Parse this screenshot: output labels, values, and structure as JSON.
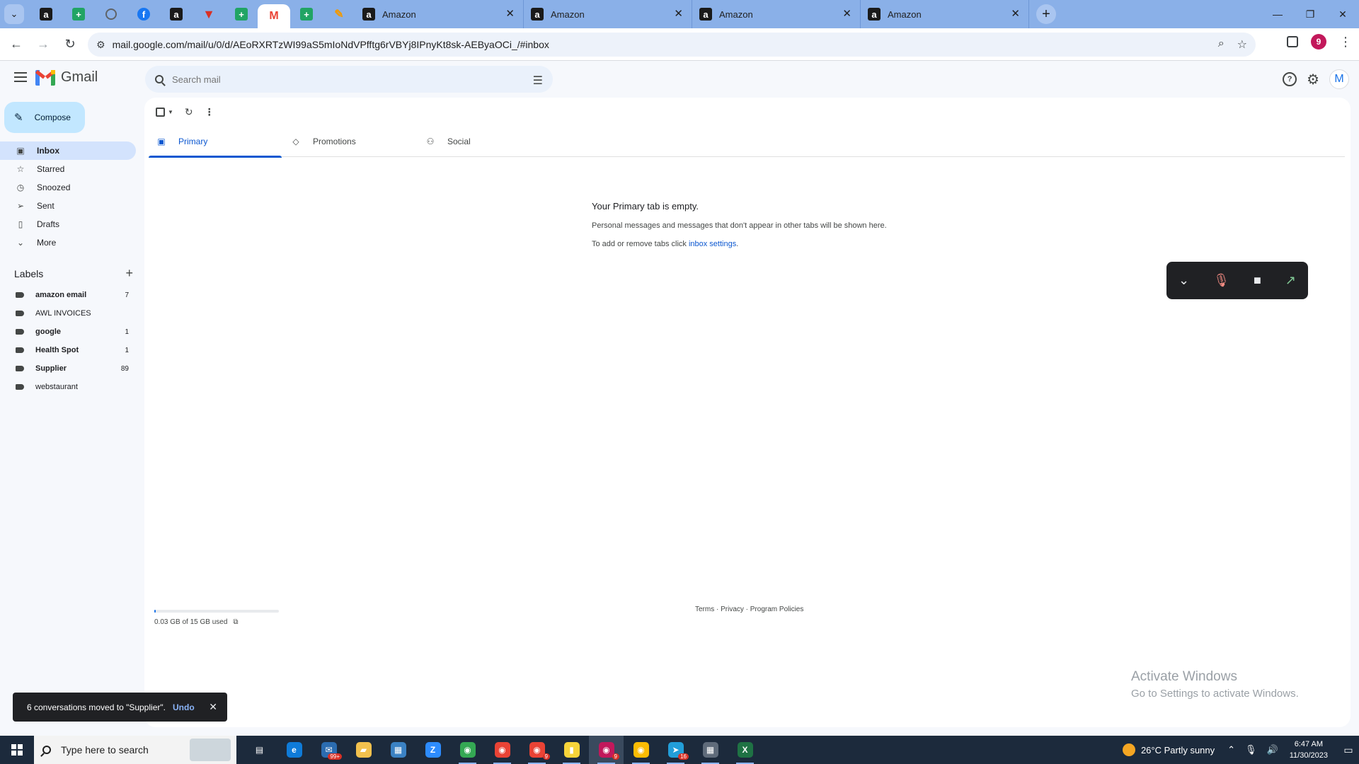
{
  "browser": {
    "pinned_tabs": [
      {
        "icon": "amazon-icon",
        "glyph": "a",
        "kind": "amz"
      },
      {
        "icon": "sheets-icon",
        "glyph": "+",
        "kind": "sheet"
      },
      {
        "icon": "globe-icon",
        "glyph": "",
        "kind": "globe"
      },
      {
        "icon": "facebook-icon",
        "glyph": "f",
        "kind": "fb"
      },
      {
        "icon": "amazon-icon",
        "glyph": "a",
        "kind": "amz"
      },
      {
        "icon": "red-shield-icon",
        "glyph": "▼",
        "kind": "red"
      },
      {
        "icon": "sheets-icon",
        "glyph": "+",
        "kind": "sheet"
      },
      {
        "icon": "gmail-icon",
        "glyph": "M",
        "kind": "gmail",
        "active": true
      },
      {
        "icon": "sheets-icon",
        "glyph": "+",
        "kind": "sheet"
      },
      {
        "icon": "feather-icon",
        "glyph": "✎",
        "kind": "feather"
      }
    ],
    "tabs": [
      {
        "title": "Amazon"
      },
      {
        "title": "Amazon"
      },
      {
        "title": "Amazon"
      },
      {
        "title": "Amazon"
      }
    ],
    "url": "mail.google.com/mail/u/0/d/AEoRXRTzWI99aS5mIoNdVPfftg6rVBYj8IPnyKt8sk-AEByaOCi_/#inbox",
    "profile_initial": "9"
  },
  "gmail": {
    "logo_text": "Gmail",
    "search_placeholder": "Search mail",
    "avatar_initial": "M",
    "compose_label": "Compose",
    "nav": [
      {
        "label": "Inbox",
        "icon": "inbox-icon",
        "glyph": "▣",
        "active": true
      },
      {
        "label": "Starred",
        "icon": "star-icon",
        "glyph": "☆"
      },
      {
        "label": "Snoozed",
        "icon": "clock-icon",
        "glyph": "◷"
      },
      {
        "label": "Sent",
        "icon": "send-icon",
        "glyph": "➢"
      },
      {
        "label": "Drafts",
        "icon": "draft-icon",
        "glyph": "▯"
      },
      {
        "label": "More",
        "icon": "chevron-down-icon",
        "glyph": "⌄"
      }
    ],
    "labels_heading": "Labels",
    "labels": [
      {
        "name": "amazon email",
        "count": "7",
        "bold": true
      },
      {
        "name": "AWL INVOICES",
        "count": "",
        "bold": false
      },
      {
        "name": "google",
        "count": "1",
        "bold": true
      },
      {
        "name": "Health Spot",
        "count": "1",
        "bold": true
      },
      {
        "name": "Supplier",
        "count": "89",
        "bold": true
      },
      {
        "name": "webstaurant",
        "count": "",
        "bold": false
      }
    ],
    "category_tabs": [
      {
        "label": "Primary",
        "icon": "inbox-icon",
        "glyph": "▣",
        "active": true
      },
      {
        "label": "Promotions",
        "icon": "tag-icon",
        "glyph": "◇"
      },
      {
        "label": "Social",
        "icon": "people-icon",
        "glyph": "⚇"
      }
    ],
    "empty": {
      "title": "Your Primary tab is empty.",
      "line1": "Personal messages and messages that don't appear in other tabs will be shown here.",
      "line2_prefix": "To add or remove tabs click ",
      "line2_link": "inbox settings",
      "line2_suffix": "."
    },
    "storage": {
      "text": "0.03 GB of 15 GB used",
      "fraction": 0.002
    },
    "footer": "Terms · Privacy · Program Policies",
    "snackbar": {
      "message": "6 conversations moved to \"Supplier\".",
      "action": "Undo"
    }
  },
  "watermark": {
    "line1": "Activate Windows",
    "line2": "Go to Settings to activate Windows."
  },
  "taskbar": {
    "search_placeholder": "Type here to search",
    "apps": [
      {
        "icon": "task-view-icon",
        "glyph": "▤",
        "color": "transparent"
      },
      {
        "icon": "edge-icon",
        "glyph": "e",
        "color": "#0f7bd8"
      },
      {
        "icon": "mail-icon",
        "glyph": "✉",
        "color": "#2b6cb0",
        "badge": "99+"
      },
      {
        "icon": "file-explorer-icon",
        "glyph": "▰",
        "color": "#f2c14e"
      },
      {
        "icon": "store-icon",
        "glyph": "▦",
        "color": "#3b82c4"
      },
      {
        "icon": "zoom-icon",
        "glyph": "Z",
        "color": "#2d8cff"
      },
      {
        "icon": "chrome-icon",
        "glyph": "◉",
        "color": "#34a853"
      },
      {
        "icon": "chrome-icon",
        "glyph": "◉",
        "color": "#ea4335"
      },
      {
        "icon": "chrome-icon",
        "glyph": "◉",
        "color": "#ea4335",
        "badge": "9"
      },
      {
        "icon": "sticky-notes-icon",
        "glyph": "▮",
        "color": "#f7d43a"
      },
      {
        "icon": "chrome-icon",
        "glyph": "◉",
        "color": "#c2185b",
        "badge": "9",
        "active": true
      },
      {
        "icon": "chrome-icon",
        "glyph": "◉",
        "color": "#fbbc04"
      },
      {
        "icon": "telegram-icon",
        "glyph": "➤",
        "color": "#229ed9",
        "badge": "16"
      },
      {
        "icon": "calculator-icon",
        "glyph": "▦",
        "color": "#5f6b7a"
      },
      {
        "icon": "excel-icon",
        "glyph": "X",
        "color": "#1f7244"
      }
    ],
    "weather": "26°C  Partly sunny",
    "time": "6:47 AM",
    "date": "11/30/2023"
  }
}
